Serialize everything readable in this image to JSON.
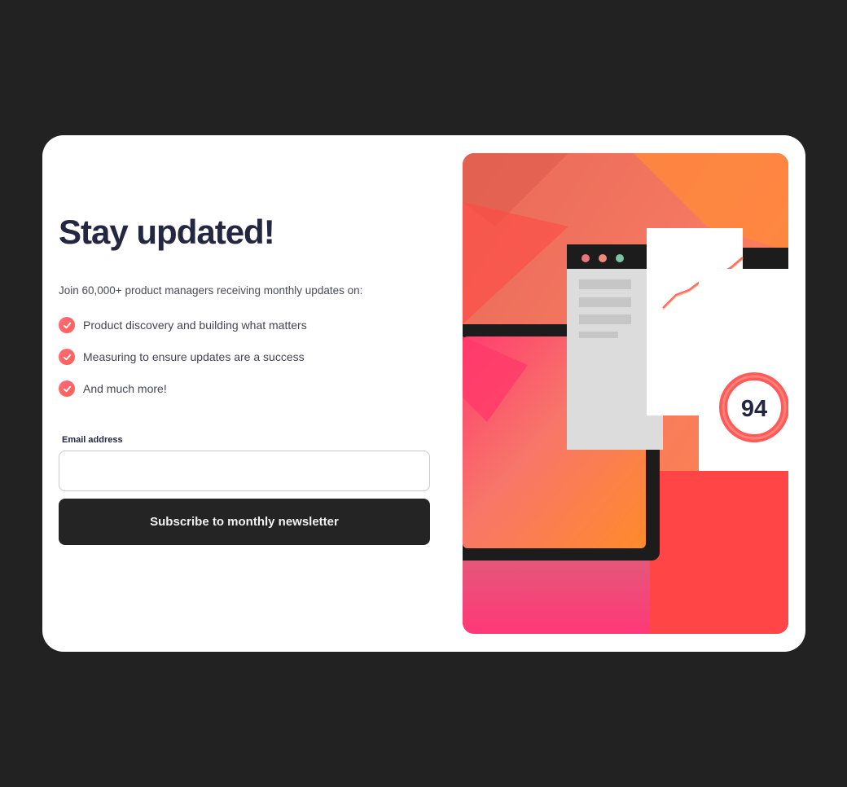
{
  "signup": {
    "title": "Stay updated!",
    "intro": "Join 60,000+ product managers receiving monthly updates on:",
    "features": [
      "Product discovery and building what matters",
      "Measuring to ensure updates are a success",
      "And much more!"
    ],
    "email_label": "Email address",
    "email_placeholder": "",
    "email_value": "",
    "button_label": "Subscribe to monthly newsletter"
  },
  "illustration": {
    "score": "94"
  },
  "colors": {
    "page_bg": "#222222",
    "card_bg": "#ffffff",
    "dark_text": "#242742",
    "button_bg": "#242424",
    "accent_pink": "#ff527b",
    "accent_orange": "#ff6a3a",
    "accent_red": "#ff4a4a"
  }
}
